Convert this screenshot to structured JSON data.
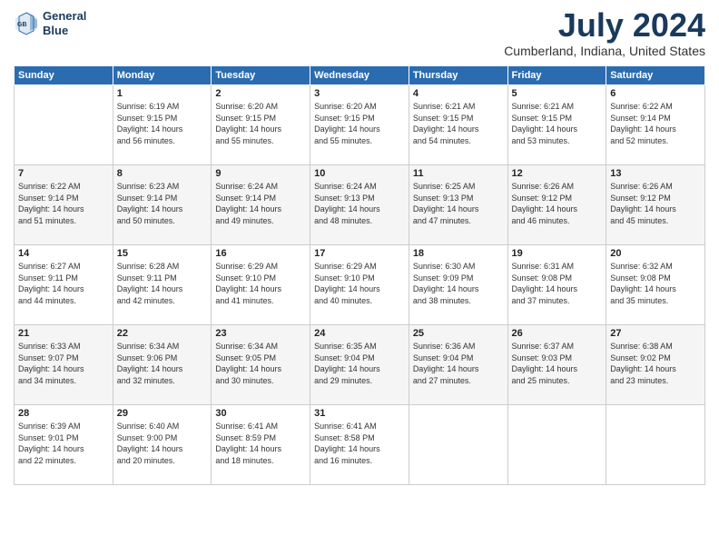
{
  "header": {
    "logo_line1": "General",
    "logo_line2": "Blue",
    "month": "July 2024",
    "location": "Cumberland, Indiana, United States"
  },
  "days_of_week": [
    "Sunday",
    "Monday",
    "Tuesday",
    "Wednesday",
    "Thursday",
    "Friday",
    "Saturday"
  ],
  "weeks": [
    [
      {
        "day": "",
        "sunrise": "",
        "sunset": "",
        "daylight": ""
      },
      {
        "day": "1",
        "sunrise": "6:19 AM",
        "sunset": "9:15 PM",
        "daylight": "14 hours and 56 minutes."
      },
      {
        "day": "2",
        "sunrise": "6:20 AM",
        "sunset": "9:15 PM",
        "daylight": "14 hours and 55 minutes."
      },
      {
        "day": "3",
        "sunrise": "6:20 AM",
        "sunset": "9:15 PM",
        "daylight": "14 hours and 55 minutes."
      },
      {
        "day": "4",
        "sunrise": "6:21 AM",
        "sunset": "9:15 PM",
        "daylight": "14 hours and 54 minutes."
      },
      {
        "day": "5",
        "sunrise": "6:21 AM",
        "sunset": "9:15 PM",
        "daylight": "14 hours and 53 minutes."
      },
      {
        "day": "6",
        "sunrise": "6:22 AM",
        "sunset": "9:14 PM",
        "daylight": "14 hours and 52 minutes."
      }
    ],
    [
      {
        "day": "7",
        "sunrise": "6:22 AM",
        "sunset": "9:14 PM",
        "daylight": "14 hours and 51 minutes."
      },
      {
        "day": "8",
        "sunrise": "6:23 AM",
        "sunset": "9:14 PM",
        "daylight": "14 hours and 50 minutes."
      },
      {
        "day": "9",
        "sunrise": "6:24 AM",
        "sunset": "9:14 PM",
        "daylight": "14 hours and 49 minutes."
      },
      {
        "day": "10",
        "sunrise": "6:24 AM",
        "sunset": "9:13 PM",
        "daylight": "14 hours and 48 minutes."
      },
      {
        "day": "11",
        "sunrise": "6:25 AM",
        "sunset": "9:13 PM",
        "daylight": "14 hours and 47 minutes."
      },
      {
        "day": "12",
        "sunrise": "6:26 AM",
        "sunset": "9:12 PM",
        "daylight": "14 hours and 46 minutes."
      },
      {
        "day": "13",
        "sunrise": "6:26 AM",
        "sunset": "9:12 PM",
        "daylight": "14 hours and 45 minutes."
      }
    ],
    [
      {
        "day": "14",
        "sunrise": "6:27 AM",
        "sunset": "9:11 PM",
        "daylight": "14 hours and 44 minutes."
      },
      {
        "day": "15",
        "sunrise": "6:28 AM",
        "sunset": "9:11 PM",
        "daylight": "14 hours and 42 minutes."
      },
      {
        "day": "16",
        "sunrise": "6:29 AM",
        "sunset": "9:10 PM",
        "daylight": "14 hours and 41 minutes."
      },
      {
        "day": "17",
        "sunrise": "6:29 AM",
        "sunset": "9:10 PM",
        "daylight": "14 hours and 40 minutes."
      },
      {
        "day": "18",
        "sunrise": "6:30 AM",
        "sunset": "9:09 PM",
        "daylight": "14 hours and 38 minutes."
      },
      {
        "day": "19",
        "sunrise": "6:31 AM",
        "sunset": "9:08 PM",
        "daylight": "14 hours and 37 minutes."
      },
      {
        "day": "20",
        "sunrise": "6:32 AM",
        "sunset": "9:08 PM",
        "daylight": "14 hours and 35 minutes."
      }
    ],
    [
      {
        "day": "21",
        "sunrise": "6:33 AM",
        "sunset": "9:07 PM",
        "daylight": "14 hours and 34 minutes."
      },
      {
        "day": "22",
        "sunrise": "6:34 AM",
        "sunset": "9:06 PM",
        "daylight": "14 hours and 32 minutes."
      },
      {
        "day": "23",
        "sunrise": "6:34 AM",
        "sunset": "9:05 PM",
        "daylight": "14 hours and 30 minutes."
      },
      {
        "day": "24",
        "sunrise": "6:35 AM",
        "sunset": "9:04 PM",
        "daylight": "14 hours and 29 minutes."
      },
      {
        "day": "25",
        "sunrise": "6:36 AM",
        "sunset": "9:04 PM",
        "daylight": "14 hours and 27 minutes."
      },
      {
        "day": "26",
        "sunrise": "6:37 AM",
        "sunset": "9:03 PM",
        "daylight": "14 hours and 25 minutes."
      },
      {
        "day": "27",
        "sunrise": "6:38 AM",
        "sunset": "9:02 PM",
        "daylight": "14 hours and 23 minutes."
      }
    ],
    [
      {
        "day": "28",
        "sunrise": "6:39 AM",
        "sunset": "9:01 PM",
        "daylight": "14 hours and 22 minutes."
      },
      {
        "day": "29",
        "sunrise": "6:40 AM",
        "sunset": "9:00 PM",
        "daylight": "14 hours and 20 minutes."
      },
      {
        "day": "30",
        "sunrise": "6:41 AM",
        "sunset": "8:59 PM",
        "daylight": "14 hours and 18 minutes."
      },
      {
        "day": "31",
        "sunrise": "6:41 AM",
        "sunset": "8:58 PM",
        "daylight": "14 hours and 16 minutes."
      },
      {
        "day": "",
        "sunrise": "",
        "sunset": "",
        "daylight": ""
      },
      {
        "day": "",
        "sunrise": "",
        "sunset": "",
        "daylight": ""
      },
      {
        "day": "",
        "sunrise": "",
        "sunset": "",
        "daylight": ""
      }
    ]
  ],
  "labels": {
    "sunrise_prefix": "Sunrise: ",
    "sunset_prefix": "Sunset: ",
    "daylight_prefix": "Daylight: "
  }
}
